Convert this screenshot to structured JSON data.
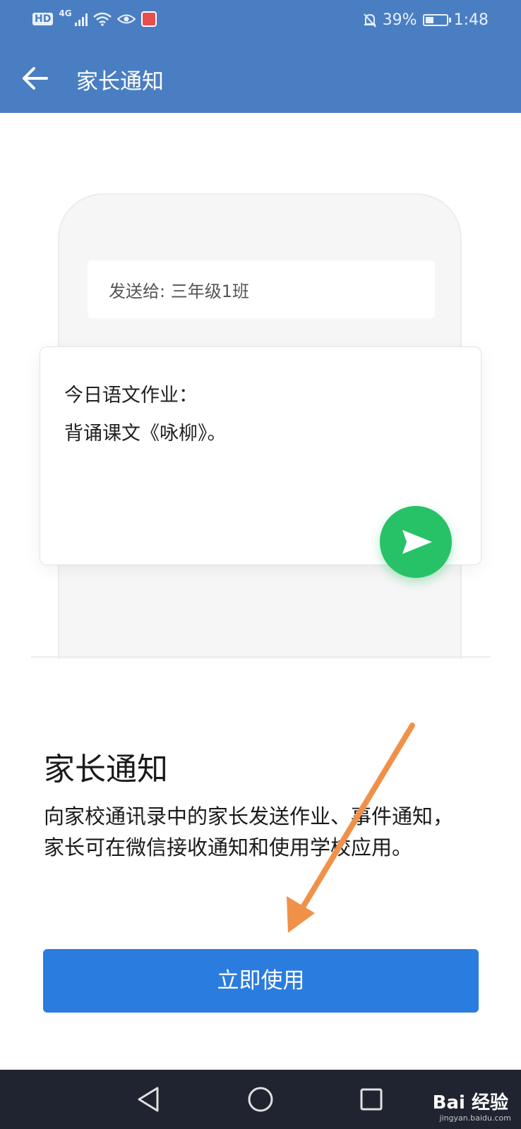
{
  "status_bar": {
    "hd": "HD",
    "network": "4G",
    "battery_percent": "39%",
    "battery_level": 0.39,
    "time": "1:48"
  },
  "header": {
    "title": "家长通知",
    "back_icon": "arrow-left-icon"
  },
  "illustration": {
    "recipient": "发送给: 三年级1班",
    "message_line1": "今日语文作业：",
    "message_line2": "背诵课文《咏柳》。",
    "send_icon": "paper-plane-icon"
  },
  "feature": {
    "title": "家长通知",
    "description": "向家校通讯录中的家长发送作业、事件通知，家长可在微信接收通知和使用学校应用。"
  },
  "cta": {
    "label": "立即使用"
  },
  "nav": {
    "back": "triangle-back-icon",
    "home": "circle-home-icon",
    "recent": "square-recent-icon"
  },
  "watermark": {
    "brand": "Bai 经验",
    "url": "jingyan.baidu.com"
  },
  "colors": {
    "header": "#4a7ec2",
    "button": "#2a7ddf",
    "send": "#27c267",
    "arrow": "#f0914a"
  }
}
